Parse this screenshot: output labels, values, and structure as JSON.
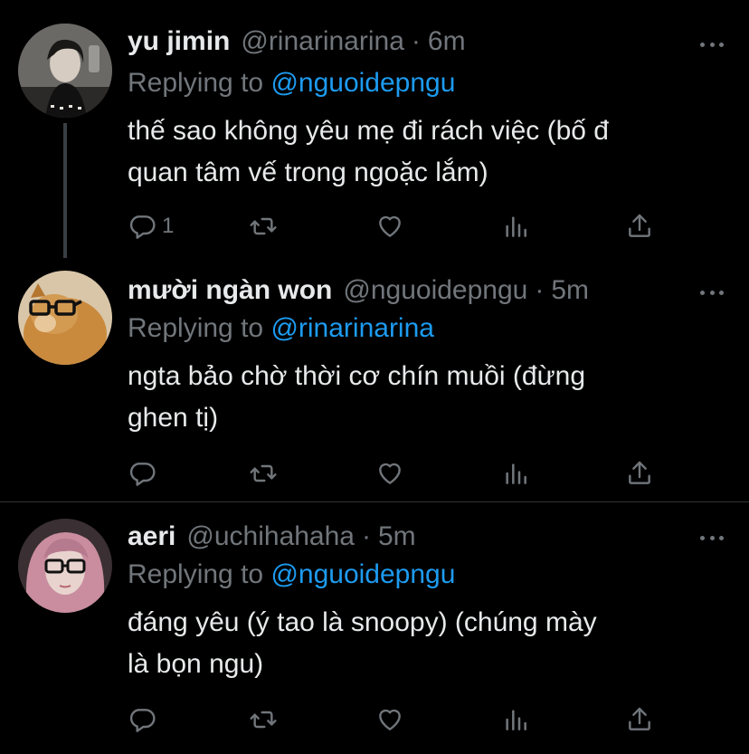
{
  "tweets": [
    {
      "name": "yu jimin",
      "handle": "@rinarinarina",
      "sep": "·",
      "time": "6m",
      "replying_label": "Replying to",
      "replying_to": "@nguoidepngu",
      "text": "thế sao không yêu mẹ đi rách việc (bố đ\nquan tâm vế trong ngoặc lắm)",
      "reply_count": "1"
    },
    {
      "name": "mười ngàn won",
      "handle": "@nguoidepngu",
      "sep": "·",
      "time": "5m",
      "replying_label": "Replying to",
      "replying_to": "@rinarinarina",
      "text": "ngta bảo chờ thời cơ chín muồi (đừng\nghen tị)",
      "reply_count": ""
    },
    {
      "name": "aeri",
      "handle": "@uchihahaha",
      "sep": "·",
      "time": "5m",
      "replying_label": "Replying to",
      "replying_to": "@nguoidepngu",
      "text": "đáng yêu (ý tao là snoopy) (chúng mày\nlà bọn ngu)",
      "reply_count": ""
    }
  ],
  "icons": {
    "reply": "reply-icon",
    "retweet": "retweet-icon",
    "like": "heart-icon",
    "analytics": "analytics-icon",
    "share": "share-icon",
    "more": "more-icon"
  },
  "colors": {
    "background": "#000000",
    "text": "#e7e9ea",
    "muted": "#71767b",
    "accent": "#1d9bf0",
    "divider": "#2f3336"
  }
}
